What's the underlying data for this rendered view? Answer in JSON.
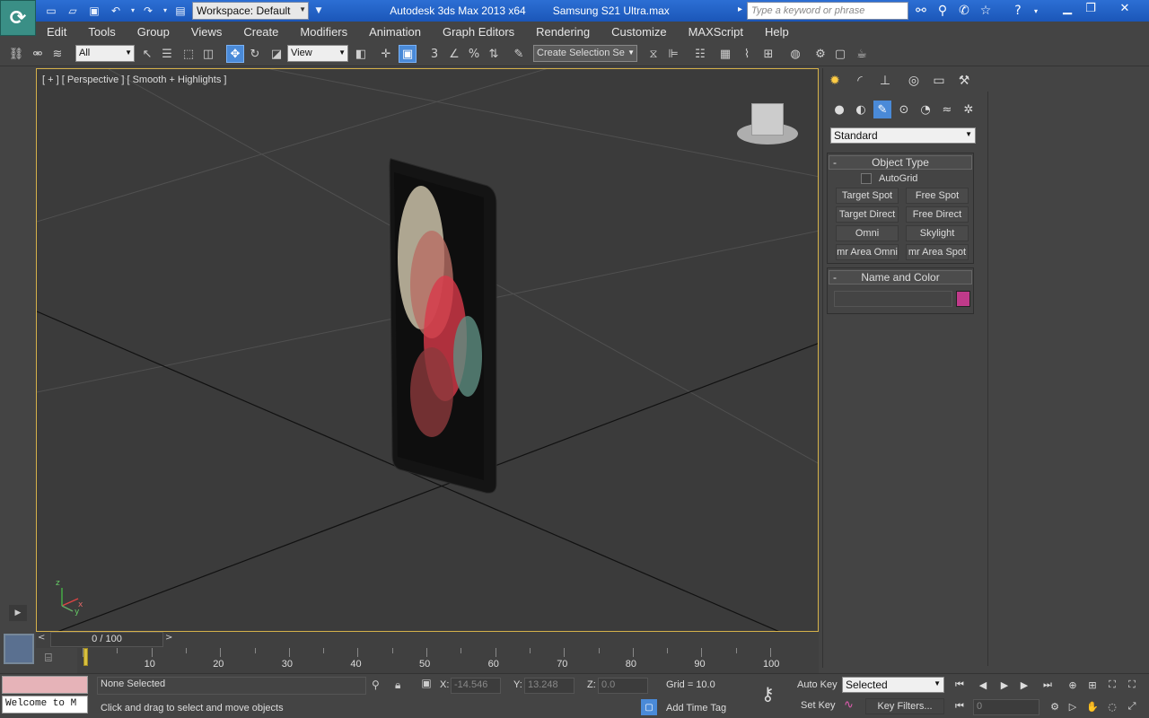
{
  "titlebar": {
    "workspace": "Workspace: Default",
    "app_title": "Autodesk 3ds Max  2013 x64",
    "file_name": "Samsung S21 Ultra.max",
    "search_placeholder": "Type a keyword or phrase"
  },
  "menu": [
    "Edit",
    "Tools",
    "Group",
    "Views",
    "Create",
    "Modifiers",
    "Animation",
    "Graph Editors",
    "Rendering",
    "Customize",
    "MAXScript",
    "Help"
  ],
  "toolbar": {
    "selection_filter": "All",
    "ref_coord": "View",
    "named_selection": "Create Selection Se"
  },
  "viewport": {
    "label": "[ + ] [ Perspective ] [ Smooth + Highlights ]",
    "axis_x": "x",
    "axis_y": "y",
    "axis_z": "z"
  },
  "command_panel": {
    "category_dropdown": "Standard",
    "object_type_title": "Object Type",
    "autogrid_label": "AutoGrid",
    "autogrid_checked": false,
    "buttons": [
      "Target Spot",
      "Free Spot",
      "Target Direct",
      "Free Direct",
      "Omni",
      "Skylight",
      "mr Area Omni",
      "mr Area Spot"
    ],
    "name_color_title": "Name and Color",
    "object_name": "",
    "swatch_color": "#c03a8a"
  },
  "timeline": {
    "frame_display": "0 / 100",
    "ticks": [
      "10",
      "20",
      "30",
      "40",
      "50",
      "60",
      "70",
      "80",
      "90",
      "100"
    ]
  },
  "status": {
    "selection": "None Selected",
    "prompt": "Click and drag to select and move objects",
    "maxscript_listener": "Welcome to M",
    "x_label": "X:",
    "x_value": "-14.546",
    "y_label": "Y:",
    "y_value": "13.248",
    "z_label": "Z:",
    "z_value": "0.0",
    "grid": "Grid = 10.0",
    "add_time_tag": "Add Time Tag",
    "auto_key": "Auto Key",
    "set_key": "Set Key",
    "key_mode_dropdown": "Selected",
    "key_filters": "Key Filters...",
    "current_frame": "0"
  }
}
